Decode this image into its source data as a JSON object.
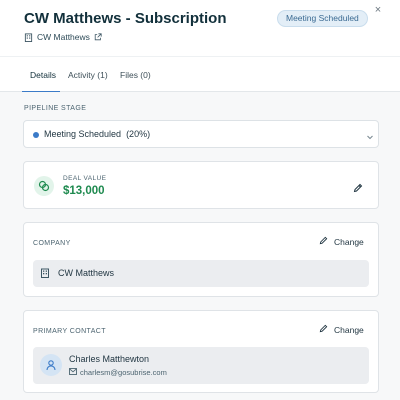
{
  "header": {
    "title": "CW Matthews - Subscription",
    "status_badge": "Meeting Scheduled",
    "close_glyph": "×",
    "company_link": "CW Matthews"
  },
  "tabs": [
    {
      "label": "Details",
      "active": true
    },
    {
      "label": "Activity (1)",
      "active": false
    },
    {
      "label": "Files (0)",
      "active": false
    }
  ],
  "pipeline": {
    "label": "PIPELINE STAGE",
    "stage": "Meeting Scheduled",
    "percent": "(20%)"
  },
  "deal": {
    "label": "DEAL VALUE",
    "value": "$13,000"
  },
  "company": {
    "label": "COMPANY",
    "change_label": "Change",
    "name": "CW Matthews"
  },
  "contact": {
    "label": "PRIMARY CONTACT",
    "change_label": "Change",
    "name": "Charles Matthewton",
    "email": "charlesm@gosubrise.com"
  },
  "colors": {
    "accent": "#3b7bc8",
    "deal_green": "#1e8a4f",
    "badge_bg": "#e3eef7"
  },
  "icons": [
    "building-icon",
    "external-link-icon",
    "close-icon",
    "chevron-down-icon",
    "coins-icon",
    "pencil-icon",
    "user-icon",
    "mail-icon"
  ]
}
